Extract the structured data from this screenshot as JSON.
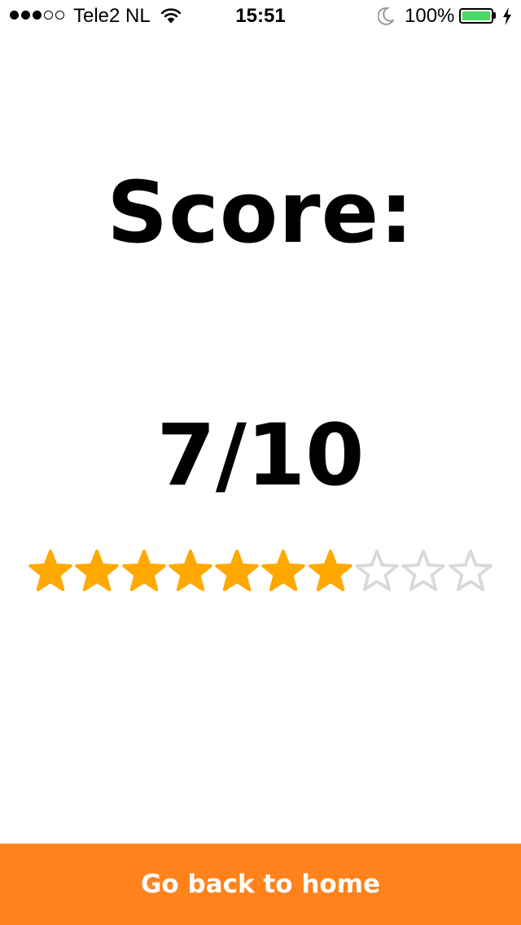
{
  "status_bar": {
    "signal_dots": [
      true,
      true,
      true,
      false,
      false
    ],
    "carrier": "Tele2 NL",
    "time": "15:51",
    "battery_percent": "100%",
    "battery_level": 1.0,
    "icons": [
      "signal-dots-icon",
      "wifi-icon",
      "moon-icon",
      "battery-icon",
      "charging-bolt-icon"
    ]
  },
  "result": {
    "title": "Score:",
    "score_text": "7/10",
    "rating": {
      "value": 7,
      "max": 10
    }
  },
  "actions": {
    "home_label": "Go back to home"
  },
  "colors": {
    "star_filled": "#ffa800",
    "star_empty": "#d9d9d9",
    "button_bg": "#ff821c",
    "button_text": "#ffffff",
    "battery_fill": "#4cd964"
  }
}
